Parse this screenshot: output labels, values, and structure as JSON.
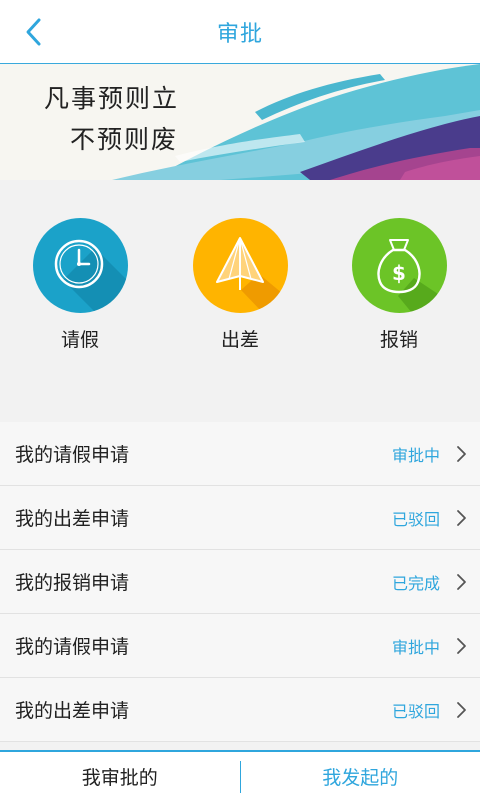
{
  "header": {
    "title": "审批",
    "back_icon": "chevron-left-icon"
  },
  "banner": {
    "line1": "凡事预则立",
    "line2": "不预则废"
  },
  "categories": [
    {
      "label": "请假",
      "icon": "clock-icon",
      "color": "#1ba2c9"
    },
    {
      "label": "出差",
      "icon": "paper-plane-icon",
      "color": "#ffb400"
    },
    {
      "label": "报销",
      "icon": "money-bag-icon",
      "color": "#6cc427"
    }
  ],
  "requests": [
    {
      "title": "我的请假申请",
      "status": "审批中"
    },
    {
      "title": "我的出差申请",
      "status": "已驳回"
    },
    {
      "title": "我的报销申请",
      "status": "已完成"
    },
    {
      "title": "我的请假申请",
      "status": "审批中"
    },
    {
      "title": "我的出差申请",
      "status": "已驳回"
    }
  ],
  "tabs": {
    "approve": "我审批的",
    "initiated": "我发起的"
  },
  "colors": {
    "accent": "#2fa6dd"
  }
}
